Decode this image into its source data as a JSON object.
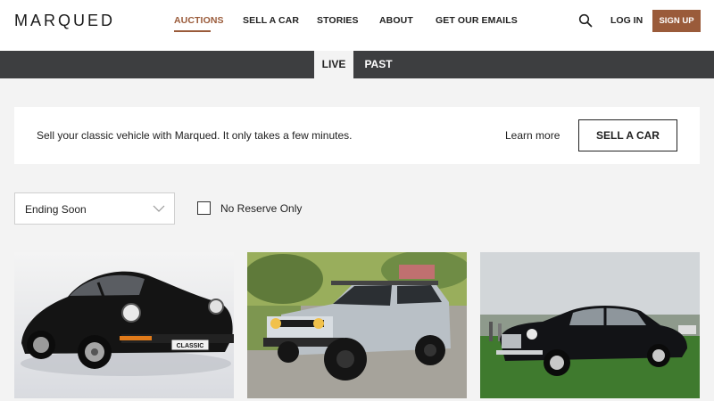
{
  "brand": {
    "name": "MARQUED"
  },
  "nav": {
    "items": [
      {
        "label": "AUCTIONS",
        "active": true
      },
      {
        "label": "SELL A CAR",
        "active": false
      },
      {
        "label": "STORIES",
        "active": false
      },
      {
        "label": "ABOUT",
        "active": false
      },
      {
        "label": "GET OUR EMAILS",
        "active": false
      }
    ],
    "login_label": "LOG IN",
    "signup_label": "SIGN UP",
    "search_icon": "search-icon"
  },
  "tabs": [
    {
      "label": "LIVE",
      "selected": true
    },
    {
      "label": "PAST",
      "selected": false
    }
  ],
  "banner": {
    "text": "Sell your classic vehicle with Marqued. It only takes a few minutes.",
    "learn_more": "Learn more",
    "cta": "SELL A CAR"
  },
  "filters": {
    "sort_value": "Ending Soon",
    "no_reserve_label": "No Reserve Only",
    "no_reserve_checked": false
  },
  "listings": [
    {
      "image": "black-porsche-911-photo",
      "plate_text": "CLASSIC"
    },
    {
      "image": "silver-toyota-fj-cruiser-photo"
    },
    {
      "image": "black-vintage-coupe-concours-photo"
    }
  ],
  "colors": {
    "accent": "#9a5b3a",
    "tabbar": "#3d3e40",
    "page_bg": "#f3f3f3"
  }
}
